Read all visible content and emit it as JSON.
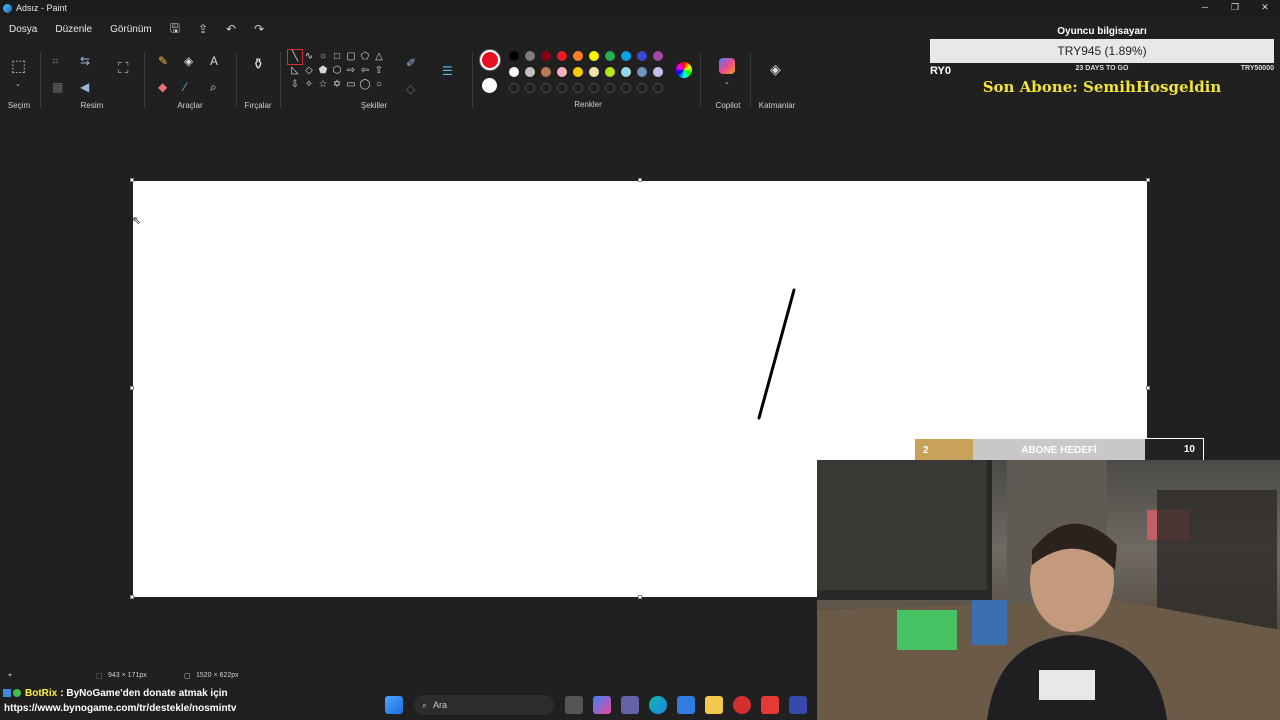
{
  "window": {
    "title": "Adsız - Paint",
    "minimize": "─",
    "maximize": "❐",
    "close": "✕"
  },
  "menu": {
    "file": "Dosya",
    "edit": "Düzenle",
    "view": "Görünüm",
    "save_icon": "💾",
    "share_icon": "⇪",
    "undo_icon": "↶",
    "redo_icon": "↷"
  },
  "ribbon": {
    "selection": "Seçim",
    "image": "Resim",
    "tools": "Araçlar",
    "brushes": "Fırçalar",
    "shapes": "Şekiller",
    "colors": "Renkler",
    "copilot": "Copilot",
    "layers": "Katmanlar"
  },
  "colors": {
    "primary": "#e81123",
    "secondary": "#ffffff",
    "row1": [
      "#000000",
      "#7f7f7f",
      "#880015",
      "#ed1c24",
      "#ff7f27",
      "#fff200",
      "#22b14c",
      "#00a2e8",
      "#3f48cc",
      "#a349a4"
    ],
    "row2": [
      "#ffffff",
      "#c3c3c3",
      "#b97a57",
      "#ffaec9",
      "#ffc90e",
      "#efe4b0",
      "#b5e61d",
      "#99d9ea",
      "#7092be",
      "#c8bfe7"
    ]
  },
  "canvas": {
    "stroke_color": "#000000"
  },
  "overlay": {
    "title": "Oyuncu bilgisayarı",
    "progress_text": "TRY945 (1.89%)",
    "start": "RY0",
    "days_left": "23 DAYS TO GO",
    "goal": "TRY50000",
    "last_sub": "Son Abone: SemihHosgeldin"
  },
  "subgoal": {
    "current": "2",
    "label": "ABONE HEDEFİ",
    "target": "10",
    "progress": 0.2
  },
  "status": {
    "cursor_icon": "⌖",
    "selection_size": "943 × 171px",
    "canvas_size": "1520 × 622px"
  },
  "chat": {
    "bot_name": "BotRix",
    "message": ": ByNoGame'den donate atmak için",
    "link": "https://www.bynogame.com/tr/destekle/nosmintv"
  },
  "taskbar": {
    "search_placeholder": "Ara"
  }
}
